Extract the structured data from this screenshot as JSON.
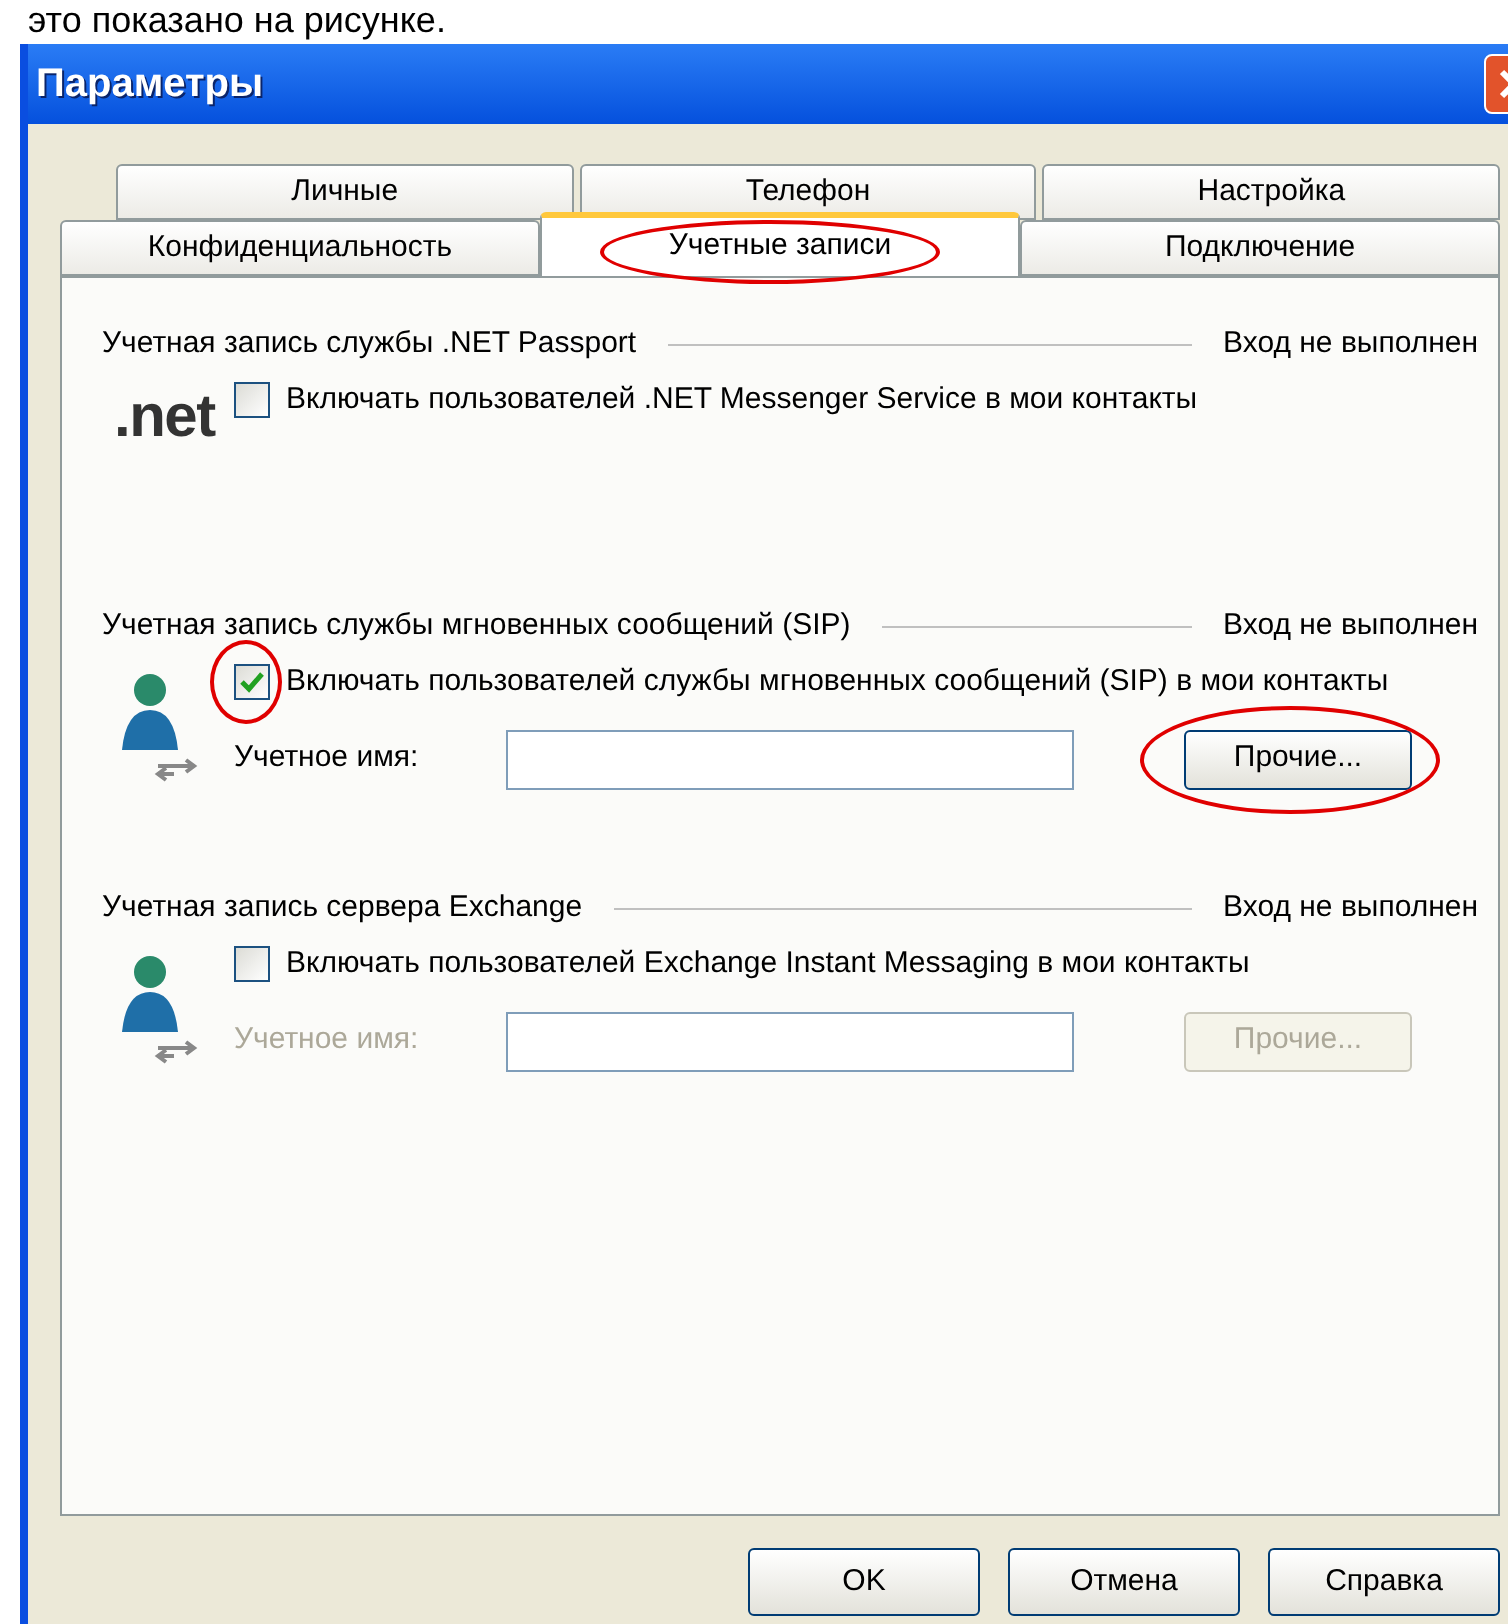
{
  "caption": "это показано на рисунке.",
  "window": {
    "title": "Параметры"
  },
  "tab_rows": [
    {
      "tabs": [
        {
          "label": "Личные",
          "selected": false,
          "highlighted": false
        },
        {
          "label": "Телефон",
          "selected": false,
          "highlighted": false
        },
        {
          "label": "Настройка",
          "selected": false,
          "highlighted": false
        }
      ]
    },
    {
      "tabs": [
        {
          "label": "Конфиденциальность",
          "selected": false,
          "highlighted": false
        },
        {
          "label": "Учетные записи",
          "selected": true,
          "highlighted": true
        },
        {
          "label": "Подключение",
          "selected": false,
          "highlighted": false
        }
      ]
    }
  ],
  "sections": [
    {
      "title": "Учетная запись службы .NET Passport",
      "status": "Вход не выполнен",
      "kind": "net",
      "logo_text": ".net",
      "checkbox": {
        "label": "Включать пользователей .NET Messenger Service в мои контакты",
        "checked": false,
        "highlighted": false
      }
    },
    {
      "title": "Учетная запись службы мгновенных сообщений (SIP)",
      "status": "Вход не выполнен",
      "kind": "person",
      "checkbox": {
        "label": "Включать пользователей службы мгновенных сообщений (SIP) в мои контакты",
        "checked": true,
        "highlighted": true
      },
      "account": {
        "label": "Учетное имя:",
        "disabled": false,
        "button": {
          "label": "Прочие...",
          "highlighted": true
        }
      }
    },
    {
      "title": "Учетная запись сервера Exchange",
      "status": "Вход не выполнен",
      "kind": "person",
      "checkbox": {
        "label": "Включать пользователей Exchange Instant Messaging в мои контакты",
        "checked": false,
        "highlighted": false
      },
      "account": {
        "label": "Учетное имя:",
        "disabled": true,
        "button": {
          "label": "Прочие...",
          "highlighted": false
        }
      }
    }
  ],
  "buttons": [
    {
      "label": "OK"
    },
    {
      "label": "Отмена"
    },
    {
      "label": "Справка"
    }
  ]
}
